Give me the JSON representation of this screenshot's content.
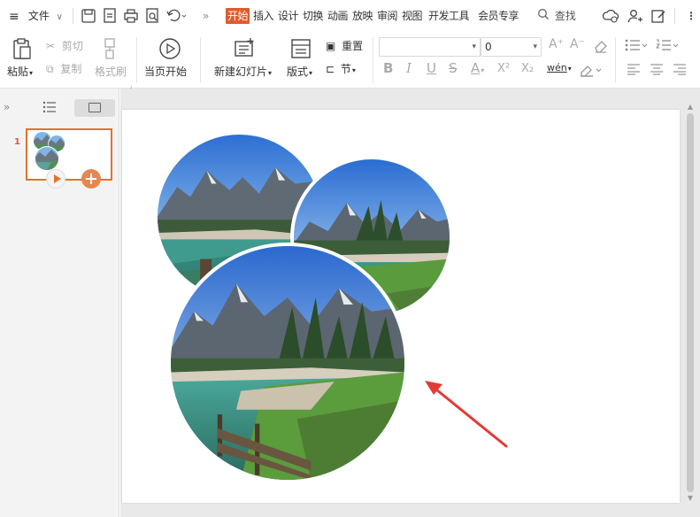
{
  "title_bar": {
    "menu_icon": "hamburger-icon",
    "file_label": "文件",
    "tabs": [
      {
        "label": "开始",
        "active": true
      },
      {
        "label": "插入",
        "active": false
      },
      {
        "label": "设计",
        "active": false
      },
      {
        "label": "切换",
        "active": false
      },
      {
        "label": "动画",
        "active": false
      },
      {
        "label": "放映",
        "active": false
      },
      {
        "label": "审阅",
        "active": false
      },
      {
        "label": "视图",
        "active": false
      },
      {
        "label": "开发工具",
        "active": false
      },
      {
        "label": "会员专享",
        "active": false
      }
    ],
    "search_label": "查找",
    "more_glyph": "»",
    "accent_color": "#e05a2b"
  },
  "ribbon": {
    "paste_label": "粘贴",
    "cut_label": "剪切",
    "copy_label": "复制",
    "format_painter_label": "格式刷",
    "play_from_current_label": "当页开始",
    "new_slide_label": "新建幻灯片",
    "layout_label": "版式",
    "reset_label": "重置",
    "section_label": "节",
    "font_name_value": "",
    "font_size_value": "0",
    "bold_glyph": "B",
    "italic_glyph": "I",
    "underline_glyph": "U",
    "strike_glyph": "S",
    "font_color_glyph": "A",
    "superscript_glyph": "X²",
    "subscript_glyph": "X₂",
    "phonetic_glyph": "wén",
    "grow_font_glyph": "A⁺",
    "shrink_font_glyph": "A⁻"
  },
  "slide_panel": {
    "collapse_glyph": "»",
    "slides": [
      {
        "number": "1"
      }
    ]
  },
  "annotation": {
    "arrow_color": "#e53935"
  }
}
